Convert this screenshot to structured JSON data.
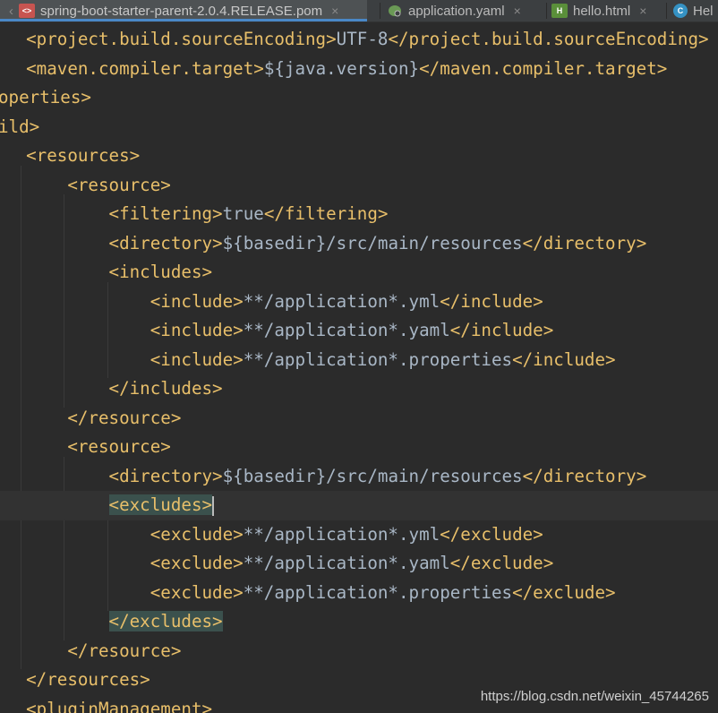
{
  "tabs": [
    {
      "label": "spring-boot-starter-parent-2.0.4.RELEASE.pom",
      "icon": "maven-xml-icon",
      "active": true
    },
    {
      "label": "application.yaml",
      "icon": "spring-leaf-icon",
      "active": false
    },
    {
      "label": "hello.html",
      "icon": "html-file-icon",
      "active": false
    },
    {
      "label": "Hel",
      "icon": "java-class-icon",
      "active": false
    }
  ],
  "code_lines": [
    {
      "indent": "  ",
      "parts": [
        [
          "tag",
          "<project.build.sourceEncoding>"
        ],
        [
          "txt",
          "UTF-8"
        ],
        [
          "tag",
          "</project.build.sourceEncoding>"
        ]
      ]
    },
    {
      "indent": "  ",
      "parts": [
        [
          "tag",
          "<maven.compiler.target>"
        ],
        [
          "txt",
          "${java.version}"
        ],
        [
          "tag",
          "</maven.compiler.target>"
        ]
      ]
    },
    {
      "indent": "",
      "parts": [
        [
          "tag",
          "operties>"
        ]
      ]
    },
    {
      "indent": "",
      "parts": [
        [
          "tag",
          "ild>"
        ]
      ]
    },
    {
      "indent": "  ",
      "parts": [
        [
          "tag",
          "<resources>"
        ]
      ]
    },
    {
      "indent": "      ",
      "parts": [
        [
          "tag",
          "<resource>"
        ]
      ]
    },
    {
      "indent": "          ",
      "parts": [
        [
          "tag",
          "<filtering>"
        ],
        [
          "txt",
          "true"
        ],
        [
          "tag",
          "</filtering>"
        ]
      ]
    },
    {
      "indent": "          ",
      "parts": [
        [
          "tag",
          "<directory>"
        ],
        [
          "txt",
          "${basedir}/src/main/resources"
        ],
        [
          "tag",
          "</directory>"
        ]
      ]
    },
    {
      "indent": "          ",
      "parts": [
        [
          "tag",
          "<includes>"
        ]
      ]
    },
    {
      "indent": "              ",
      "parts": [
        [
          "tag",
          "<include>"
        ],
        [
          "txt",
          "**/application*.yml"
        ],
        [
          "tag",
          "</include>"
        ]
      ]
    },
    {
      "indent": "              ",
      "parts": [
        [
          "tag",
          "<include>"
        ],
        [
          "txt",
          "**/application*.yaml"
        ],
        [
          "tag",
          "</include>"
        ]
      ]
    },
    {
      "indent": "              ",
      "parts": [
        [
          "tag",
          "<include>"
        ],
        [
          "txt",
          "**/application*.properties"
        ],
        [
          "tag",
          "</include>"
        ]
      ]
    },
    {
      "indent": "          ",
      "parts": [
        [
          "tag",
          "</includes>"
        ]
      ]
    },
    {
      "indent": "      ",
      "parts": [
        [
          "tag",
          "</resource>"
        ]
      ]
    },
    {
      "indent": "      ",
      "parts": [
        [
          "tag",
          "<resource>"
        ]
      ]
    },
    {
      "indent": "          ",
      "parts": [
        [
          "tag",
          "<directory>"
        ],
        [
          "txt",
          "${basedir}/src/main/resources"
        ],
        [
          "tag",
          "</directory>"
        ]
      ]
    },
    {
      "indent": "          ",
      "parts": [
        [
          "hltag",
          "<excludes>"
        ]
      ],
      "caret": true
    },
    {
      "indent": "              ",
      "parts": [
        [
          "tag",
          "<exclude>"
        ],
        [
          "txt",
          "**/application*.yml"
        ],
        [
          "tag",
          "</exclude>"
        ]
      ]
    },
    {
      "indent": "              ",
      "parts": [
        [
          "tag",
          "<exclude>"
        ],
        [
          "txt",
          "**/application*.yaml"
        ],
        [
          "tag",
          "</exclude>"
        ]
      ]
    },
    {
      "indent": "              ",
      "parts": [
        [
          "tag",
          "<exclude>"
        ],
        [
          "txt",
          "**/application*.properties"
        ],
        [
          "tag",
          "</exclude>"
        ]
      ]
    },
    {
      "indent": "          ",
      "parts": [
        [
          "hltag",
          "</excludes>"
        ]
      ]
    },
    {
      "indent": "      ",
      "parts": [
        [
          "tag",
          "</resource>"
        ]
      ]
    },
    {
      "indent": "  ",
      "parts": [
        [
          "tag",
          "</resources>"
        ]
      ]
    },
    {
      "indent": "  ",
      "parts": [
        [
          "tag",
          "<pluginManagement>"
        ]
      ]
    }
  ],
  "watermark": "https://blog.csdn.net/weixin_45744265",
  "colors": {
    "background": "#2b2b2b",
    "tag": "#e8bf6a",
    "text": "#a9b7c6",
    "match_highlight": "#3b514d",
    "tab_bar": "#3c3f41",
    "active_tab_underline": "#4a88c7"
  }
}
